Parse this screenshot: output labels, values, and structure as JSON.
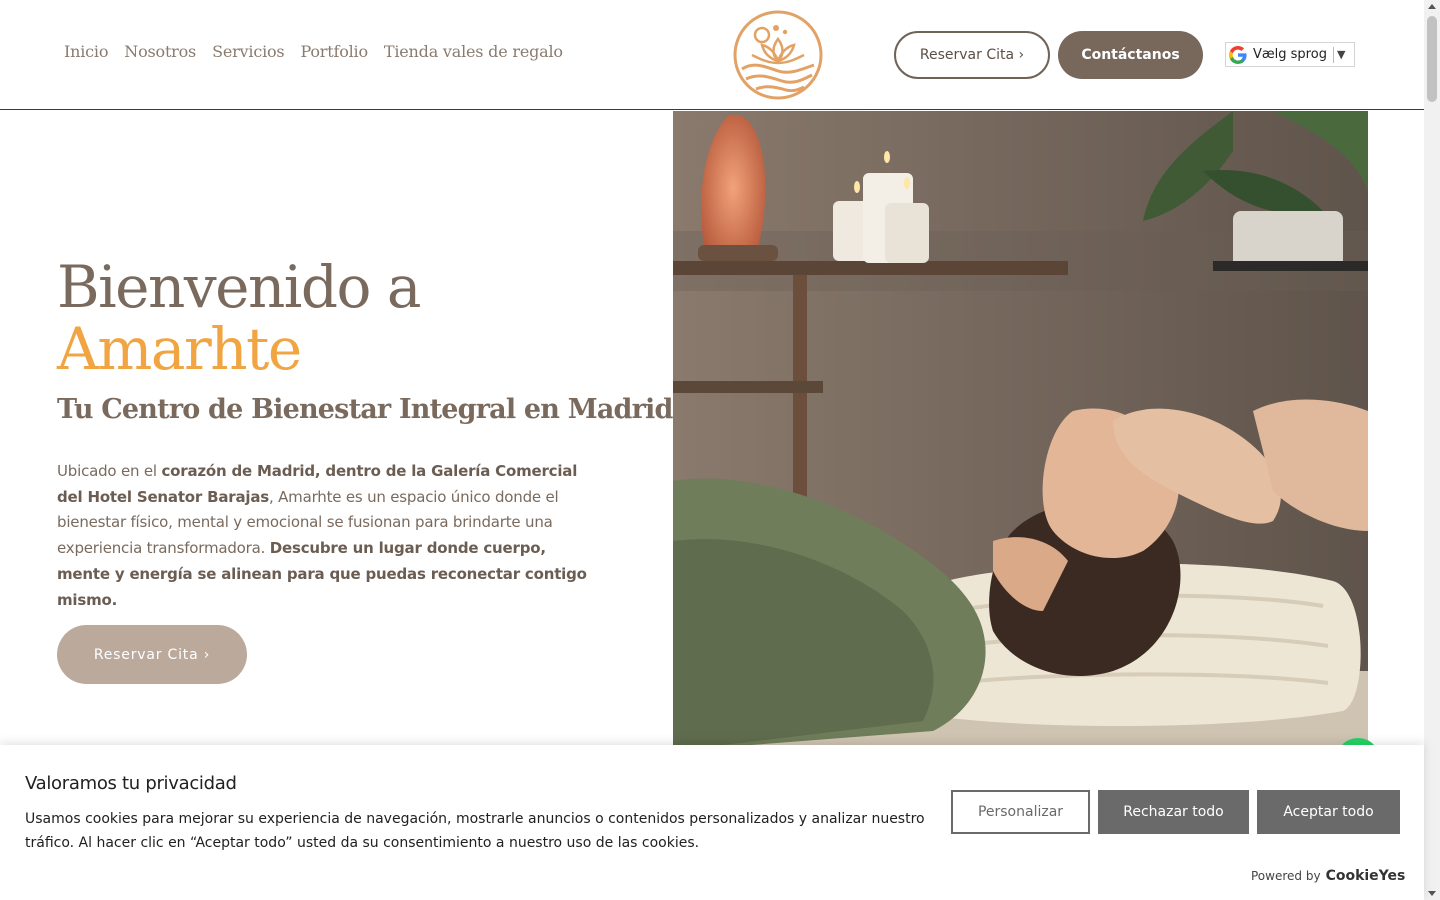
{
  "nav": {
    "items": [
      {
        "label": "Inicio"
      },
      {
        "label": "Nosotros"
      },
      {
        "label": "Servicios"
      },
      {
        "label": "Portfolio"
      },
      {
        "label": "Tienda vales de regalo"
      }
    ]
  },
  "header": {
    "book_label": "Reservar Cita ›",
    "contact_label": "Contáctanos",
    "translate_label": "Vælg sprog",
    "translate_arrow": "▼"
  },
  "hero": {
    "title_line1": "Bienvenido a",
    "title_line2": "Amarhte",
    "subtitle": "Tu Centro de Bienestar Integral en Madrid",
    "text": {
      "p1": "Ubicado en el ",
      "b1": "corazón de Madrid, dentro de la Galería Comercial del Hotel Senator Barajas",
      "p2": ", Amarhte es un espacio único donde el bienestar físico, mental y emocional se fusionan para brindarte una experiencia transformadora. ",
      "b2": "Descubre un lugar donde cuerpo, mente y energía se alinean para que puedas reconectar contigo mismo."
    },
    "cta_label": "Reservar Cita ›"
  },
  "cookie": {
    "title": "Valoramos tu privacidad",
    "description": "Usamos cookies para mejorar su experiencia de navegación, mostrarle anuncios o contenidos personalizados y analizar nuestro tráfico. Al hacer clic en “Aceptar todo” usted da su consentimiento a nuestro uso de las cookies.",
    "customize_label": "Personalizar",
    "reject_label": "Rechazar todo",
    "accept_label": "Aceptar todo",
    "powered_by": "Powered by",
    "powered_brand": "CookieYes"
  },
  "colors": {
    "accent": "#f0a542",
    "brand_brown": "#78685c",
    "text_brown": "#7a6a5e",
    "button_tan": "#bba99c",
    "cookie_button_gray": "#6a6a6a"
  }
}
